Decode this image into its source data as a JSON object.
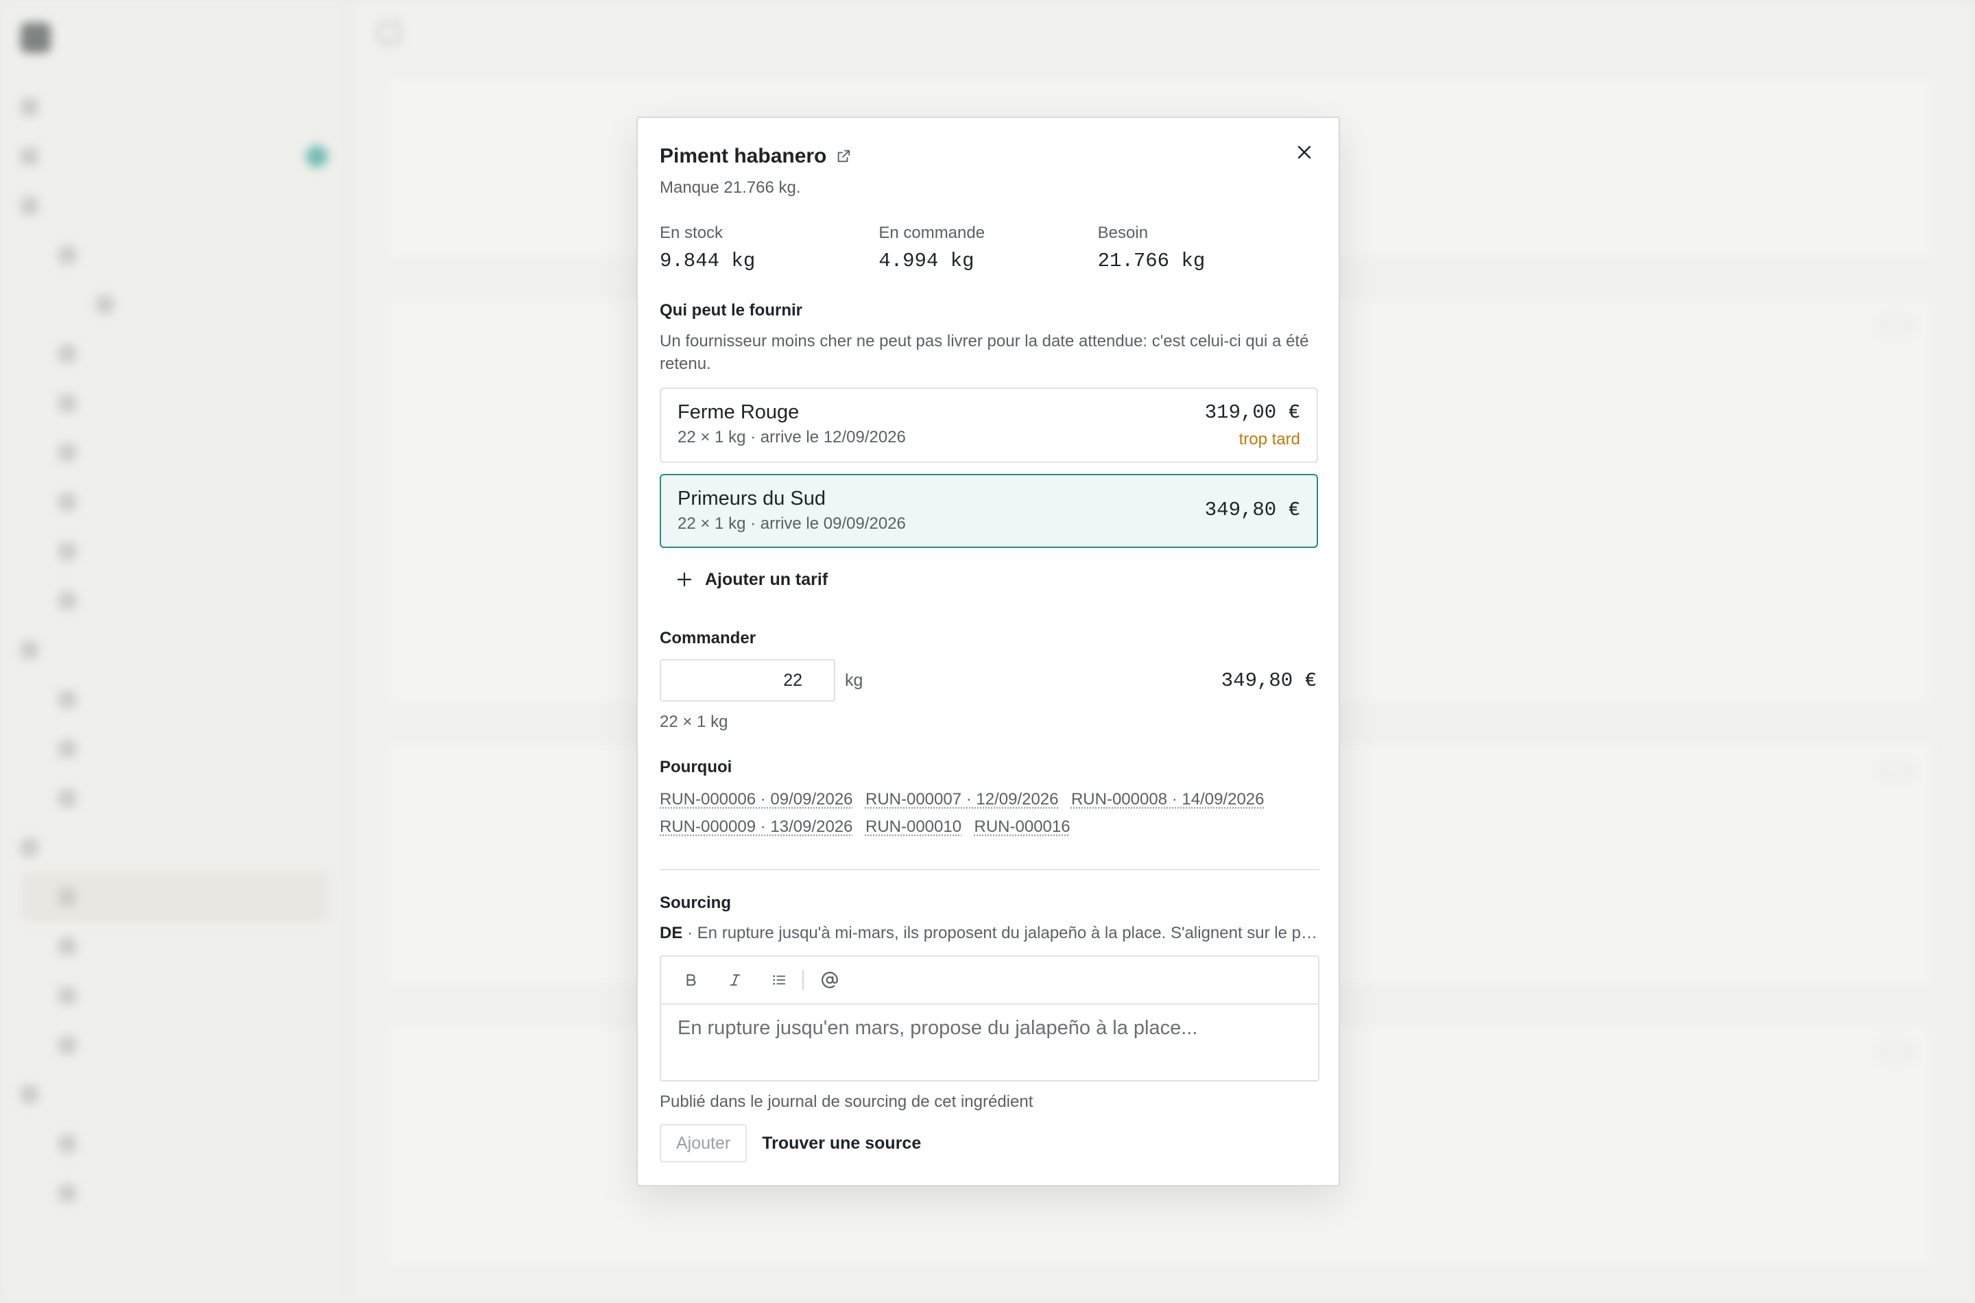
{
  "modal": {
    "title": "Piment habanero",
    "subtitle": "Manque 21.766 kg.",
    "stats": [
      {
        "label": "En stock",
        "value": "9.844 kg"
      },
      {
        "label": "En commande",
        "value": "4.994 kg"
      },
      {
        "label": "Besoin",
        "value": "21.766 kg"
      }
    ],
    "suppliers_section": {
      "title": "Qui peut le fournir",
      "explanation": "Un fournisseur moins cher ne peut pas livrer pour la date attendue: c'est celui-ci qui a été retenu.",
      "suppliers": [
        {
          "name": "Ferme Rouge",
          "detail": "22 × 1 kg · arrive le 12/09/2026",
          "price": "319,00 €",
          "status": "trop tard",
          "selected": false
        },
        {
          "name": "Primeurs du Sud",
          "detail": "22 × 1 kg · arrive le 09/09/2026",
          "price": "349,80 €",
          "status": "",
          "selected": true
        }
      ],
      "add_tarif_label": "Ajouter un tarif"
    },
    "order": {
      "title": "Commander",
      "quantity": "22",
      "unit": "kg",
      "total": "349,80 €",
      "packaging": "22 × 1 kg"
    },
    "why": {
      "title": "Pourquoi",
      "runs": [
        "RUN-000006 · 09/09/2026",
        "RUN-000007 · 12/09/2026",
        "RUN-000008 · 14/09/2026",
        "RUN-000009 · 13/09/2026",
        "RUN-000010",
        "RUN-000016"
      ]
    },
    "sourcing": {
      "title": "Sourcing",
      "note_author": "DE",
      "note_text": " · En rupture jusqu'à mi-mars, ils proposent du jalapeño à la place. S'alignent sur le prix de Ferme Rouge.",
      "editor_placeholder": "En rupture jusqu'en mars, propose du jalapeño à la place...",
      "helper": "Publié dans le journal de sourcing de cet ingrédient",
      "add_button": "Ajouter",
      "find_button": "Trouver une source"
    }
  },
  "colors": {
    "accent": "#1f8f82",
    "warning": "#c27a0a"
  }
}
